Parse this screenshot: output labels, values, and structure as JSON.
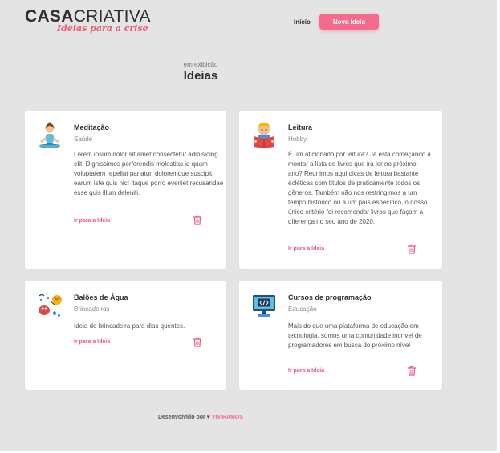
{
  "header": {
    "logo_bold": "CASA",
    "logo_light": "CRIATIVA",
    "tagline": "Ideias para a crise",
    "nav_home": "Início",
    "nav_new": "Nova Ideia"
  },
  "section": {
    "subtitle": "em exibição",
    "title": "Ideias"
  },
  "ideas": [
    {
      "title": "Meditação",
      "category": "Saúde",
      "description": "Lorem ipsum dolor sit amet consectetur adipisicing elit. Dignissimos perferendis molestias id quam voluptatem repellat pariatur, doloremque suscipit, earum iste quis hic! Itaque porro eveniet recusandae esse quis illum deleniti.",
      "link": "Ir para a Ideia",
      "icon": "meditation-icon"
    },
    {
      "title": "Leitura",
      "category": "Hobby",
      "description": "É um aficionado por leitura? Já está começando a montar a lista de livros que irá ler no próximo ano? Reunimos aqui dicas de leitura bastante ecléticas com títulos de praticamente todos os gêneros. Também não nos restringimos a um tempo histórico ou a um país específico, o nosso único critério foi recomendar livros que façam a diferença no seu ano de 2020.",
      "link": "Ir para a Ideia",
      "icon": "reading-icon"
    },
    {
      "title": "Balões de Água",
      "category": "Brincadeiras",
      "description": "Ideia de brincadeira para dias quentes.",
      "link": "Ir para a Ideia",
      "icon": "water-balloons-icon"
    },
    {
      "title": "Cursos de programação",
      "category": "Educação",
      "description": "Mais do que uma plataforma de educação em tecnologia, somos uma comunidade incrível de programadores em busca do próximo nível",
      "link": "Ir para a Ideia",
      "icon": "programming-icon"
    }
  ],
  "footer": {
    "prefix": "Desenvolvido por",
    "heart": "♥",
    "brand": "VIVIRAMOS"
  },
  "colors": {
    "accent": "#f56b8a",
    "background": "#e4e4e4"
  }
}
